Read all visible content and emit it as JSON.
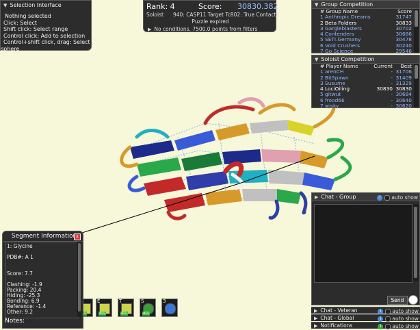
{
  "selection": {
    "title": "Selection Interface",
    "lines": [
      "Nothing selected",
      "Click: Select",
      "Shift click: Select range",
      "Control click: Add to selection",
      "Control+shift click, drag: Select",
      "sphere"
    ]
  },
  "score_panel": {
    "rank_label": "Rank: 4",
    "score_label": "Score:",
    "score_value": "30830.382",
    "mode": "Soloist",
    "puzzle": "940: CASP11 Target Tc802: True Contacts",
    "status": "Puzzle expired",
    "conditions": "No conditions. 7500.0 points from filters"
  },
  "group_competition": {
    "title": "Group Competition",
    "header": {
      "name": "# Group Name",
      "score": "Score"
    },
    "rows": [
      {
        "name": "1 Anthropic Dreams",
        "score": "31747",
        "style": "link"
      },
      {
        "name": "2 Beta Folders",
        "score": "30833",
        "style": "white"
      },
      {
        "name": "3 Gargleblasters",
        "score": "30702",
        "style": "link"
      },
      {
        "name": "4 Contenders",
        "score": "30686",
        "style": "link"
      },
      {
        "name": "5 SETI.Germany",
        "score": "30478",
        "style": "link"
      },
      {
        "name": "6 Void Crushers",
        "score": "30240",
        "style": "link"
      },
      {
        "name": "7 Go Science",
        "score": "29546",
        "style": "link"
      }
    ]
  },
  "soloist_competition": {
    "title": "Soloist Competition",
    "header": {
      "name": "# Player Name",
      "current": "Current",
      "best": "Best"
    },
    "rows": [
      {
        "name": "1  arenCH",
        "current": "-",
        "best": "31706",
        "style": "link"
      },
      {
        "name": "2 BitSpawn",
        "current": "-",
        "best": "31409",
        "style": "link"
      },
      {
        "name": "3 Susume",
        "current": "-",
        "best": "31329",
        "style": "link"
      },
      {
        "name": "4 LociOiling",
        "current": "30830",
        "best": "30830",
        "style": "white"
      },
      {
        "name": "5 gitwut",
        "current": "-",
        "best": "30684",
        "style": "link"
      },
      {
        "name": "6 frood66",
        "current": "-",
        "best": "30640",
        "style": "link"
      },
      {
        "name": "7 wisky",
        "current": "-",
        "best": "30620",
        "style": "link"
      }
    ]
  },
  "chat": {
    "group_title": "Chat - Group",
    "auto_show": "auto show",
    "send": "Send",
    "veteran_title": "Chat - Veteran",
    "global_title": "Chat - Global",
    "notifications_title": "Notifications"
  },
  "segment_info": {
    "title": "Segment Information",
    "close": "x",
    "lines": [
      "1: Glycine",
      "",
      "PDB#: A 1",
      "",
      "",
      "Score: 7.7",
      "",
      "Clashing: -1.9",
      "Packing: 20.4",
      "Hiding: -25.3",
      "Bonding: 6.9",
      "Reference: -1.4",
      "Other: 9.2"
    ],
    "notes": "Notes:"
  },
  "tools": [
    {
      "key": "",
      "icon": "yellow-all-icon"
    },
    {
      "key": "E",
      "icon": "yellow-all-icon"
    },
    {
      "key": "T",
      "icon": "yellow-all-icon"
    },
    {
      "key": "S",
      "icon": "green-all-icon"
    },
    {
      "key": "3",
      "icon": "move-icon"
    }
  ],
  "colors": {
    "background": "#f7f7d9",
    "panel": "#2c2c2c",
    "link": "#8fb4ff",
    "score_value": "#9cc4ff"
  }
}
